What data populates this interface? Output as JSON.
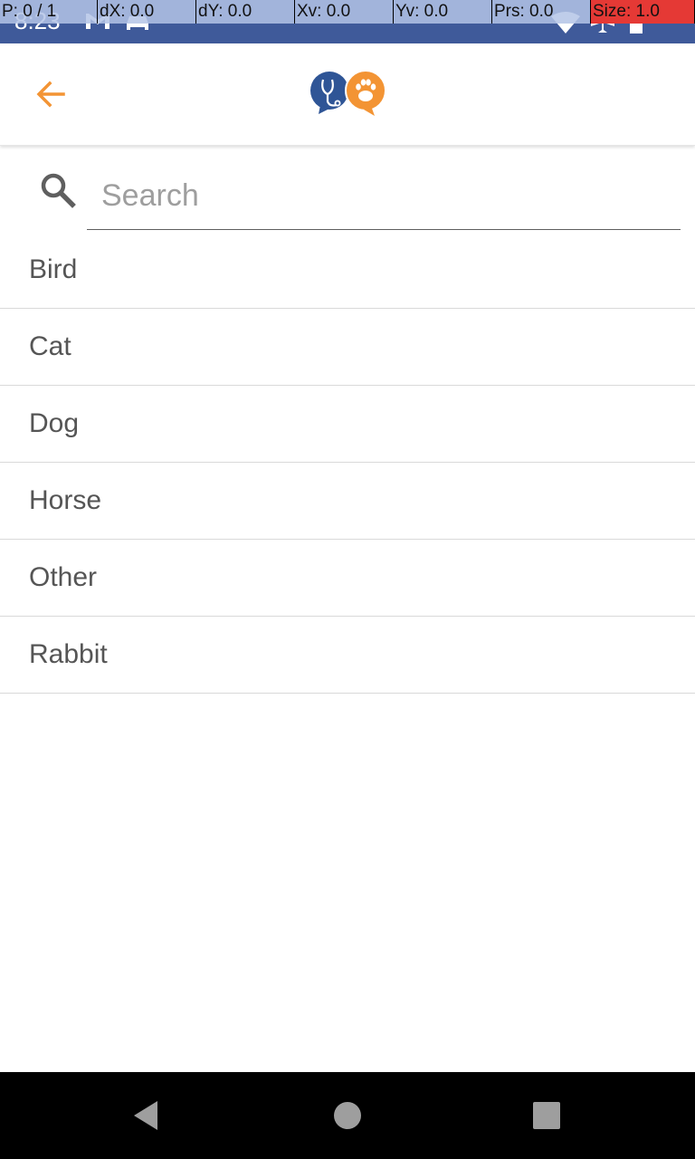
{
  "status_bar": {
    "time": "8:23",
    "icons": [
      "gmail-icon",
      "car-icon",
      "wifi-icon",
      "airplane-icon",
      "battery-icon"
    ]
  },
  "debug_overlay": {
    "cells": [
      "P: 0 / 1",
      "dX: 0.0",
      "dY: 0.0",
      "Xv: 0.0",
      "Yv: 0.0",
      "Prs: 0.0",
      "Size: 1.0"
    ]
  },
  "app_bar": {
    "back_icon": "arrow-left-icon",
    "logo": "vet-paw-logo",
    "accent_color": "#f39434",
    "logo_blue": "#2f5596"
  },
  "search": {
    "placeholder": "Search",
    "value": ""
  },
  "species": [
    "Bird",
    "Cat",
    "Dog",
    "Horse",
    "Other",
    "Rabbit"
  ],
  "nav_bar": {
    "buttons": [
      "back-triangle-icon",
      "home-circle-icon",
      "recents-square-icon"
    ]
  }
}
